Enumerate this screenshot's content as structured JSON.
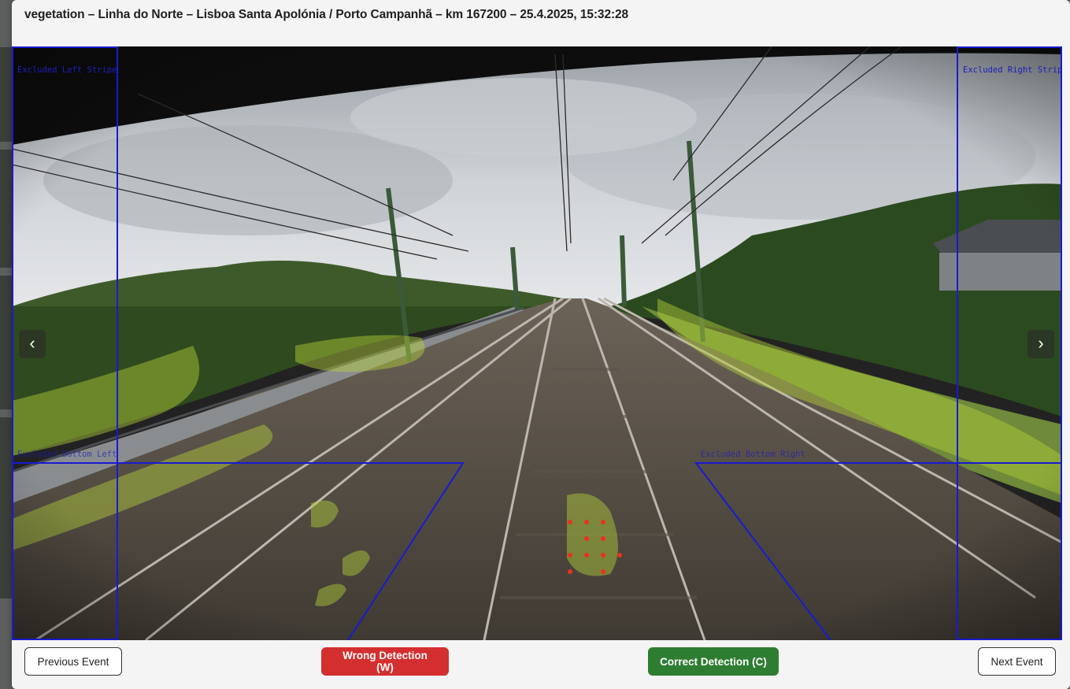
{
  "dialog": {
    "title": "vegetation – Linha do Norte – Lisboa Santa Apolónia / Porto Campanhã – km 167200 – 25.4.2025, 15:32:28"
  },
  "viewer": {
    "zones": {
      "left_stripe": "Excluded Left Stripe",
      "right_stripe": "Excluded Right Stripe",
      "bottom_left": "Excluded Bottom Left",
      "bottom_right": "Excluded Bottom Right"
    },
    "prev_arrow": "‹",
    "next_arrow": "›",
    "colors": {
      "zone_outline": "#1a1ad0",
      "vegetation_overlay": "#b5d23a",
      "detection_points": "#e8321e"
    }
  },
  "footer": {
    "previous": "Previous Event",
    "wrong": "Wrong Detection (W)",
    "correct": "Correct Detection (C)",
    "next": "Next Event"
  }
}
